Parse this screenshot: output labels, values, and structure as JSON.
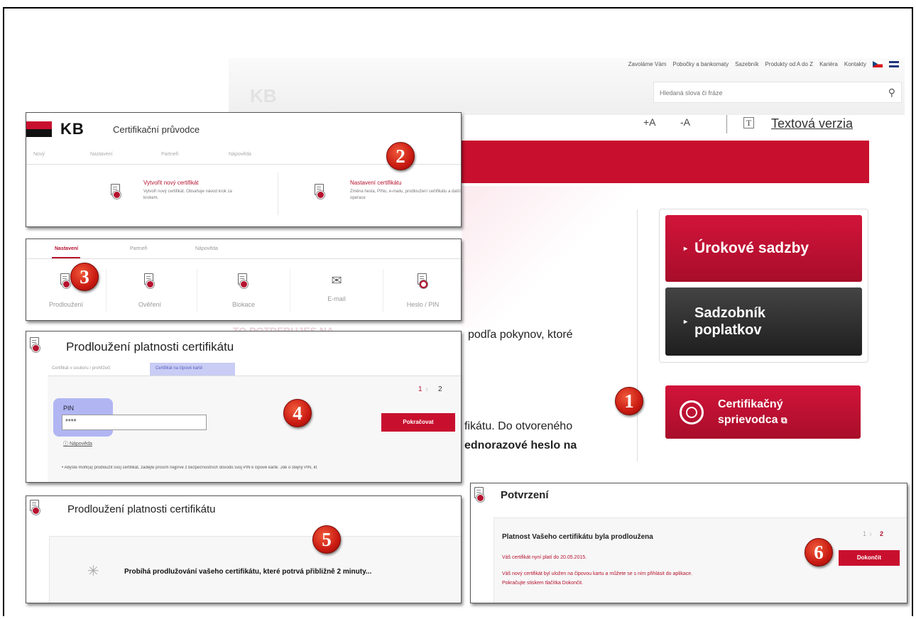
{
  "website": {
    "top_links": [
      "Zavoláme Vám",
      "Pobočky a bankomaty",
      "Sazebník",
      "Produkty od A do Z",
      "Kariéra",
      "Kontakty"
    ],
    "logo_ghost": "KB",
    "search_placeholder": "Hledaná slova či fráze",
    "zoom_in": "+A",
    "zoom_out": "-A",
    "text_version": "Textová verzia",
    "btn_rates": "Úrokové sadzby",
    "btn_fees_line1": "Sadzobník",
    "btn_fees_line2": "poplatkov",
    "btn_cert_line1": "Certifikačný",
    "btn_cert_line2": "sprievodca",
    "text_line1": "podľa pokynov, ktoré",
    "text_line2": "fikátu. Do otvoreného",
    "text_line3": "ednorazové heslo na",
    "ghost_text": "TO POTREBUJES NA",
    "colors": {
      "red": "#c8102e",
      "dark": "#2b2b2b"
    }
  },
  "panel2": {
    "logo": "KB",
    "title": "Certifikační průvodce",
    "tabs": [
      "Nový",
      "Nastavení",
      "Partneři",
      "Nápověda"
    ],
    "item1_title": "Vytvořit nový certifikát",
    "item1_desc": "Vytvoří nový certifikát. Obsahuje návod krok za krokem.",
    "item2_title": "Nastavení certifikátu",
    "item2_desc": "Změna hesla, PINu, e-mailu, prodloužení certifikátu a další operace"
  },
  "panel3": {
    "tabs": [
      "Nastavení",
      "Partneři",
      "Nápověda"
    ],
    "items": [
      "Prodloužení",
      "Ověření",
      "Blokace",
      "E-mail",
      "Heslo / PIN"
    ]
  },
  "panel4": {
    "title": "Prodloužení platnosti certifikátu",
    "tab1": "Certifikát v souboru / prohlížeči",
    "tab2": "Certifikát na čipové kartě",
    "step": "1",
    "step2": "2",
    "pin_label": "PIN",
    "pin_value": "****",
    "help": "Nápověda",
    "continue": "Pokračovat",
    "note": "Abyste mohl(a) prodloužit svůj certifikát, zadejte prosím nejprve z bezpečnostních důvodů svůj PIN k čipové kartě. Jde o stejný PIN, kt"
  },
  "panel5": {
    "title": "Prodloužení platnosti certifikátu",
    "progress_text": "Probíhá prodlužování vašeho certifikátu, které potrvá přibližně 2 minuty..."
  },
  "panel6": {
    "title": "Potvrzení",
    "heading": "Platnost Vašeho certifikátu byla prodloužena",
    "step1": "1",
    "step2": "2",
    "valid": "Váš certifikát nyní platí do 20.05.2015.",
    "info1": "Váš nový certifikát byl uložen na čipovou kartu a můžete se s ním přihlásit do aplikace.",
    "info2": "Pokračujte stiskem tlačítka Dokončit.",
    "finish": "Dokončit"
  },
  "markers": [
    "1",
    "2",
    "3",
    "4",
    "5",
    "6"
  ]
}
